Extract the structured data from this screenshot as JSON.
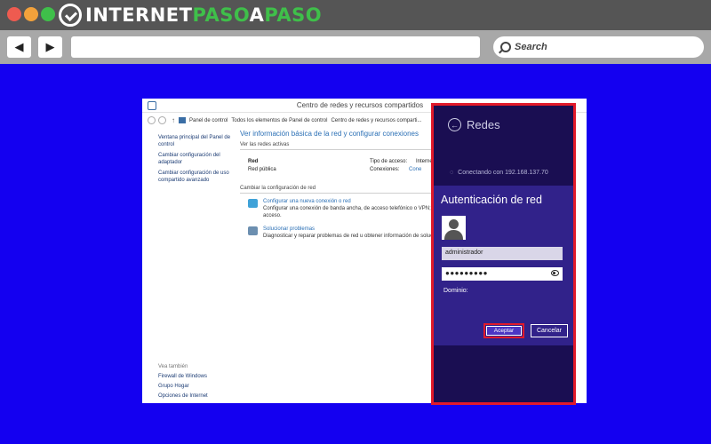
{
  "browser": {
    "logo": {
      "part1": "INTERNET",
      "part2": "PASO",
      "part3": "A",
      "part4": "PASO"
    },
    "nav": {
      "back": "◀",
      "forward": "▶"
    },
    "search_placeholder": "Search"
  },
  "window": {
    "title": "Centro de redes y recursos compartidos",
    "breadcrumb": [
      "Panel de control",
      "Todos los elementos de Panel de control",
      "Centro de redes y recursos comparti..."
    ],
    "left_nav": [
      "Ventana principal del Panel de control",
      "Cambiar configuración del adaptador",
      "Cambiar configuración de uso compartido avanzado"
    ],
    "see_also": {
      "header": "Vea también",
      "items": [
        "Firewall de Windows",
        "Grupo Hogar",
        "Opciones de Internet"
      ]
    },
    "main_title": "Ver información básica de la red y configurar conexiones",
    "active_networks_label": "Ver las redes activas",
    "network": {
      "name": "Red",
      "type": "Red pública",
      "access_label": "Tipo de acceso:",
      "access_value": "Interne",
      "connections_label": "Conexiones:",
      "connections_value": "Cone"
    },
    "change_section": "Cambiar la configuración de red",
    "tasks": [
      {
        "link": "Configurar una nueva conexión o red",
        "desc": "Configurar una conexión de banda ancha, de acceso telefónico o VPN; o bie enrutador o punto de acceso."
      },
      {
        "link": "Solucionar problemas",
        "desc": "Diagnosticar y reparar problemas de red u obtener información de solución"
      }
    ]
  },
  "panel": {
    "back_arrow": "←",
    "title": "Redes",
    "connecting": "Conectando con 192.168.137.70",
    "spinner": "◌",
    "auth_title": "Autenticación de red",
    "username": "administrador",
    "password_mask": "●●●●●●●●●",
    "domain_label": "Dominio:",
    "accept_label": "Aceptar",
    "cancel_label": "Cancelar"
  },
  "colors": {
    "background": "#1400f0",
    "highlight": "#e11a2b",
    "panel_bg": "#1a0e52",
    "auth_bg": "#31228a"
  }
}
